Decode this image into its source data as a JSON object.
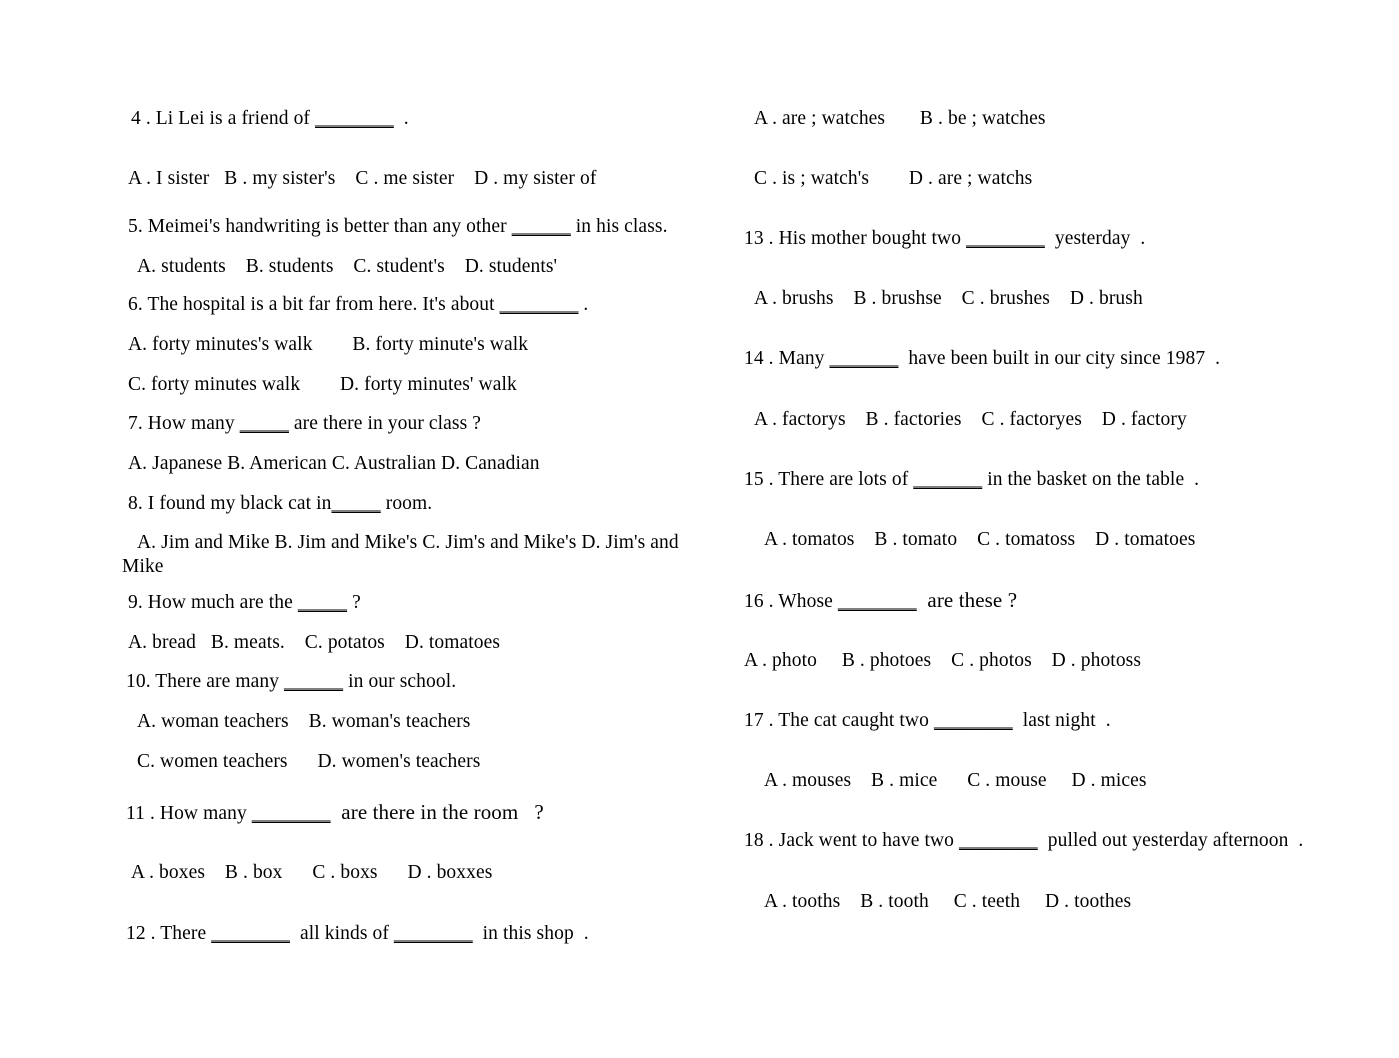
{
  "document": {
    "type": "english-grammar-worksheet",
    "background_color": "#ffffff",
    "text_color": "#000000",
    "columns": 2
  },
  "left_column": {
    "lines": [
      {
        "id": "q4_stem",
        "kind": "question",
        "number": "4",
        "text": "4 . Li Lei is a friend of ",
        "blank": "________",
        "tail": "  ."
      },
      {
        "id": "q4_options",
        "kind": "options",
        "text": "A . I sister   B . my sister's    C . me sister    D . my sister of"
      },
      {
        "id": "q5_stem",
        "kind": "question",
        "number": "5",
        "text": "5. Meimei's handwriting is better than any other ",
        "blank": "______",
        "tail": " in his class."
      },
      {
        "id": "q5_options",
        "kind": "options",
        "text": "A. students    B. students    C. student's    D. students'"
      },
      {
        "id": "q6_stem",
        "kind": "question",
        "number": "6",
        "text": "6. The hospital is a bit far from here. It's about ",
        "blank": "________",
        "tail": " ."
      },
      {
        "id": "q6_options_ab",
        "kind": "options",
        "text": "A. forty minutes's walk        B. forty minute's walk"
      },
      {
        "id": "q6_options_cd",
        "kind": "options",
        "text": "C. forty minutes walk        D. forty minutes' walk"
      },
      {
        "id": "q7_stem",
        "kind": "question",
        "number": "7",
        "text": "7. How many ",
        "blank": "_____",
        "tail": " are there in your class ?"
      },
      {
        "id": "q7_options",
        "kind": "options",
        "text": "A. Japanese B. American C. Australian D. Canadian"
      },
      {
        "id": "q8_stem",
        "kind": "question",
        "number": "8",
        "text": "8. I found my black cat in",
        "blank": "_____",
        "tail": " room."
      },
      {
        "id": "q8_options_1",
        "kind": "options",
        "text": "A. Jim and Mike B. Jim and Mike's C. Jim's and Mike's D. Jim's and"
      },
      {
        "id": "q8_options_2",
        "kind": "options",
        "text": "Mike"
      },
      {
        "id": "q9_stem",
        "kind": "question",
        "number": "9",
        "text": "9. How much are the ",
        "blank": "_____",
        "tail": " ?"
      },
      {
        "id": "q9_options",
        "kind": "options",
        "text": "A. bread   B. meats.    C. potatos    D. tomatoes"
      },
      {
        "id": "q10_stem",
        "kind": "question",
        "number": "10",
        "text": "10. There are many ",
        "blank": "______",
        "tail": " in our school."
      },
      {
        "id": "q10_options_ab",
        "kind": "options",
        "text": "A. woman teachers    B. woman's teachers"
      },
      {
        "id": "q10_options_cd",
        "kind": "options",
        "text": "C. women teachers      D. women's teachers"
      },
      {
        "id": "q11_stem",
        "kind": "question",
        "number": "11",
        "text": "11 . How many ",
        "blank": "________",
        "tail": "  are there in the room   ?"
      },
      {
        "id": "q11_options",
        "kind": "options",
        "text": "A . boxes    B . box      C . boxs      D . boxxes"
      },
      {
        "id": "q12_stem",
        "kind": "question",
        "number": "12",
        "text": "12 . There ",
        "blank": "________",
        "mid": "  all kinds of ",
        "blank2": "________",
        "tail": "  in this shop  ."
      }
    ]
  },
  "right_column": {
    "lines": [
      {
        "id": "q12_options_ab",
        "kind": "options",
        "text": "A . are ; watches       B . be ; watches"
      },
      {
        "id": "q12_options_cd",
        "kind": "options",
        "text": "C . is ; watch's        D . are ; watchs"
      },
      {
        "id": "q13_stem",
        "kind": "question",
        "number": "13",
        "text": "13 . His mother bought two ",
        "blank": "________",
        "tail": "  yesterday  ."
      },
      {
        "id": "q13_options",
        "kind": "options",
        "text": "A . brushs    B . brushse    C . brushes    D . brush"
      },
      {
        "id": "q14_stem",
        "kind": "question",
        "number": "14",
        "text": "14 . Many ",
        "blank": "_______",
        "tail": "  have been built in our city since 1987  ."
      },
      {
        "id": "q14_options",
        "kind": "options",
        "text": "A . factorys    B . factories    C . factoryes    D . factory"
      },
      {
        "id": "q15_stem",
        "kind": "question",
        "number": "15",
        "text": "15 . There are lots of ",
        "blank": "_______",
        "tail": " in the basket on the table  ."
      },
      {
        "id": "q15_options",
        "kind": "options",
        "text": "A . tomatos    B . tomato    C . tomatoss    D . tomatoes"
      },
      {
        "id": "q16_stem",
        "kind": "question",
        "number": "16",
        "text": "16 . Whose ",
        "blank": "________",
        "tail": "  are these ?"
      },
      {
        "id": "q16_options",
        "kind": "options",
        "text": "A . photo     B . photoes    C . photos    D . photoss"
      },
      {
        "id": "q17_stem",
        "kind": "question",
        "number": "17",
        "text": "17 . The cat caught two ",
        "blank": "________",
        "tail": "  last night  ."
      },
      {
        "id": "q17_options",
        "kind": "options",
        "text": "A . mouses    B . mice      C . mouse     D . mices"
      },
      {
        "id": "q18_stem",
        "kind": "question",
        "number": "18",
        "text": "18 . Jack went to have two ",
        "blank": "________",
        "tail": "  pulled out yesterday afternoon  ."
      },
      {
        "id": "q18_options",
        "kind": "options",
        "text": "A . tooths    B . tooth     C . teeth     D . toothes"
      }
    ]
  }
}
